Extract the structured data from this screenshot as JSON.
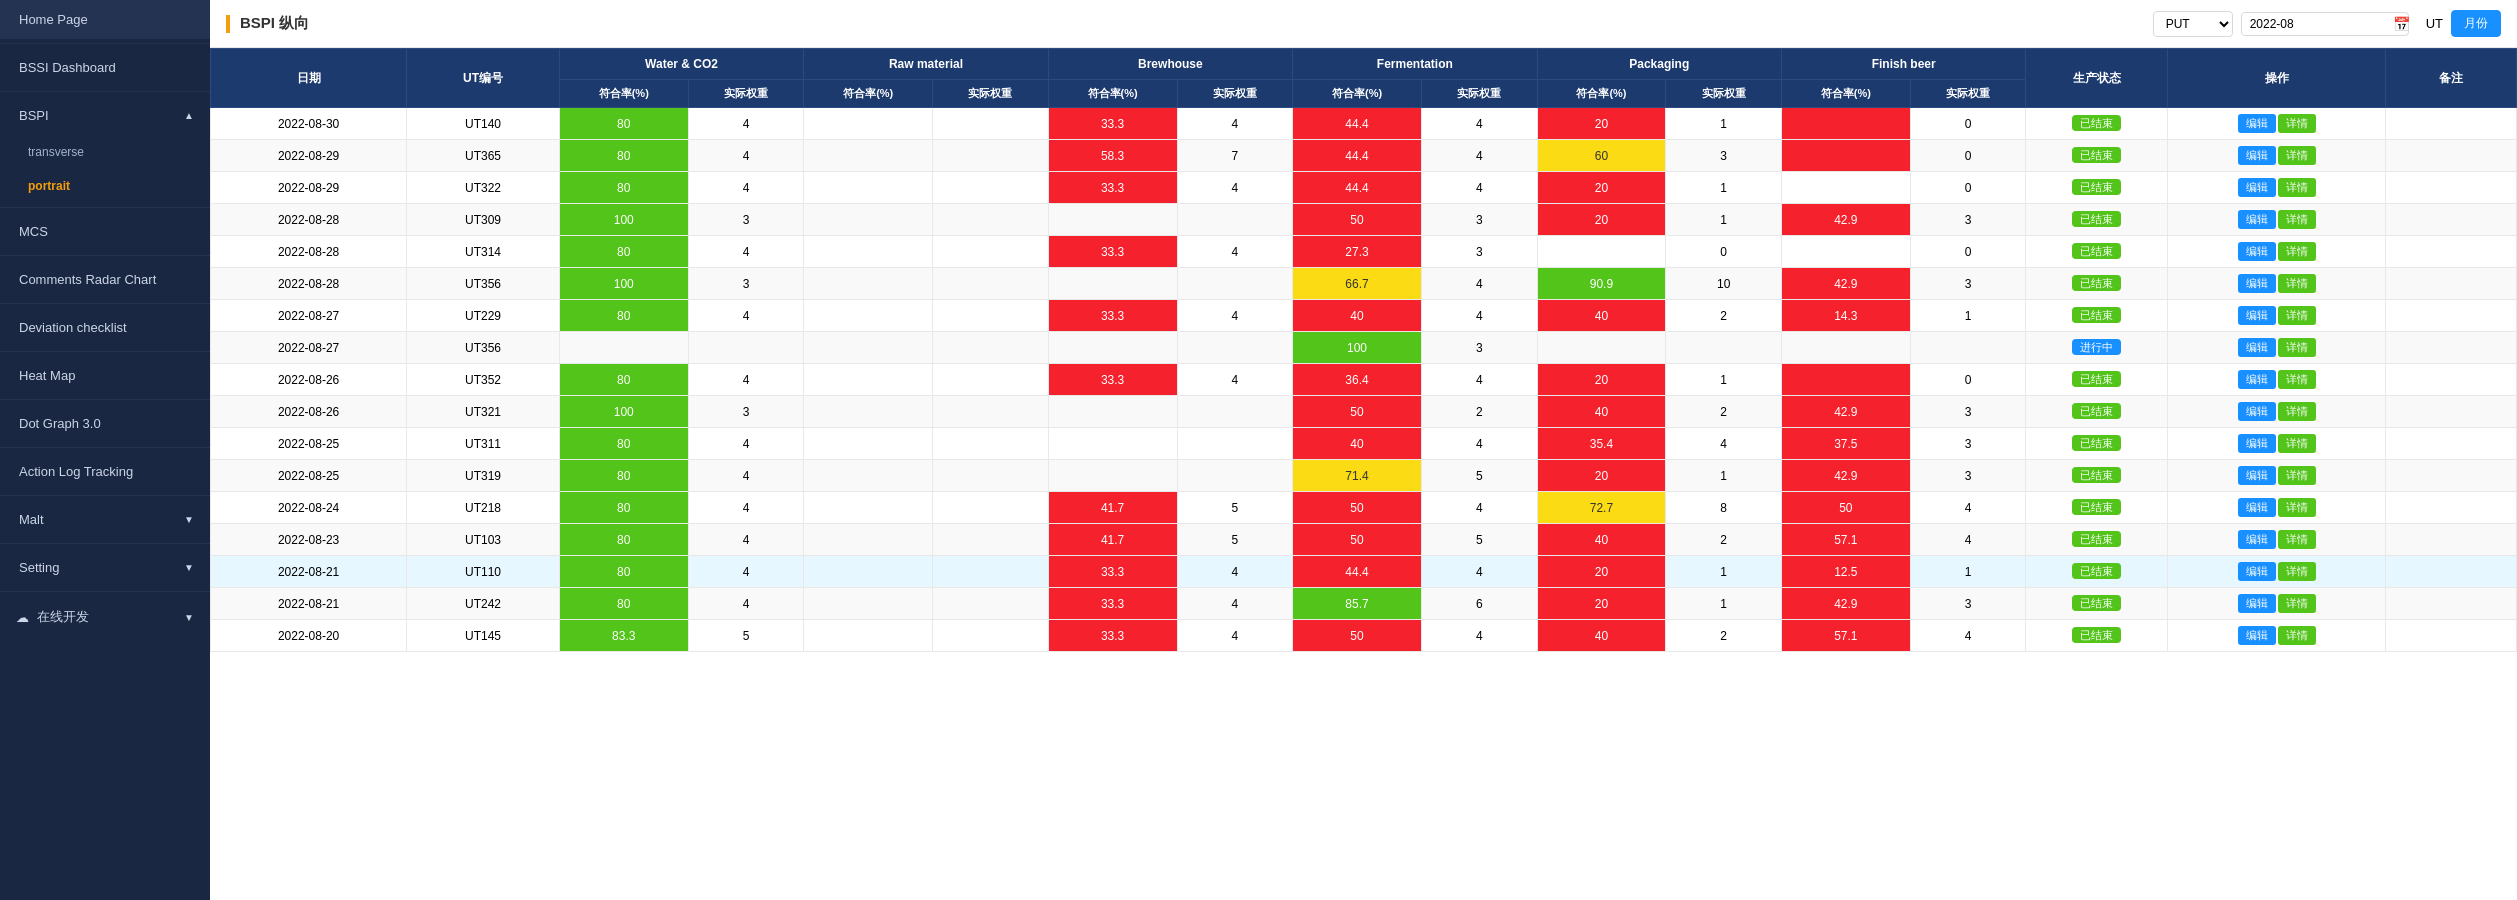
{
  "sidebar": {
    "logo": "Home Page",
    "items": [
      {
        "id": "home",
        "label": "Home Page",
        "active": false,
        "hasArrow": false
      },
      {
        "id": "bssi",
        "label": "BSSI Dashboard",
        "active": false,
        "hasArrow": false
      },
      {
        "id": "bspi",
        "label": "BSPI",
        "active": false,
        "hasArrow": true,
        "expanded": true
      },
      {
        "id": "transverse",
        "label": "transverse",
        "active": false,
        "isSub": true
      },
      {
        "id": "portrait",
        "label": "portrait",
        "active": true,
        "isSub": true
      },
      {
        "id": "mcs",
        "label": "MCS",
        "active": false,
        "hasArrow": false
      },
      {
        "id": "comments-radar",
        "label": "Comments Radar Chart",
        "active": false,
        "hasArrow": false
      },
      {
        "id": "deviation",
        "label": "Deviation checklist",
        "active": false,
        "hasArrow": false
      },
      {
        "id": "heatmap",
        "label": "Heat Map",
        "active": false,
        "hasArrow": false
      },
      {
        "id": "dotgraph",
        "label": "Dot Graph 3.0",
        "active": false,
        "hasArrow": false
      },
      {
        "id": "actionlog",
        "label": "Action Log Tracking",
        "active": false,
        "hasArrow": false
      },
      {
        "id": "malt",
        "label": "Malt",
        "active": false,
        "hasArrow": true
      },
      {
        "id": "setting",
        "label": "Setting",
        "active": false,
        "hasArrow": true
      },
      {
        "id": "online-dev",
        "label": "在线开发",
        "active": false,
        "hasArrow": true
      }
    ]
  },
  "topbar": {
    "title": "BSPI 纵向",
    "put_label": "PUT",
    "put_options": [
      "PUT"
    ],
    "date_value": "2022-08",
    "ut_label": "UT",
    "month_btn": "月份"
  },
  "table": {
    "headers_group": [
      {
        "label": "日期",
        "rowspan": 2,
        "colspan": 1
      },
      {
        "label": "UT编号",
        "rowspan": 2,
        "colspan": 1
      },
      {
        "label": "Water & CO2",
        "rowspan": 1,
        "colspan": 2
      },
      {
        "label": "Raw material",
        "rowspan": 1,
        "colspan": 2
      },
      {
        "label": "Brewhouse",
        "rowspan": 1,
        "colspan": 2
      },
      {
        "label": "Fermentation",
        "rowspan": 1,
        "colspan": 2
      },
      {
        "label": "Packaging",
        "rowspan": 1,
        "colspan": 2
      },
      {
        "label": "Finish beer",
        "rowspan": 1,
        "colspan": 2
      },
      {
        "label": "生产状态",
        "rowspan": 2,
        "colspan": 1
      },
      {
        "label": "操作",
        "rowspan": 2,
        "colspan": 1
      },
      {
        "label": "备注",
        "rowspan": 2,
        "colspan": 1
      }
    ],
    "sub_headers": [
      "符合率(%)",
      "实际权重",
      "符合率(%)",
      "实际权重",
      "符合率(%)",
      "实际权重",
      "符合率(%)",
      "实际权重",
      "符合率(%)",
      "实际权重",
      "符合率(%)",
      "实际权重"
    ],
    "rows": [
      {
        "date": "2022-08-30",
        "ut": "UT140",
        "highlighted": false,
        "water_rate": {
          "value": "80",
          "color": "green"
        },
        "water_weight": "4",
        "raw_rate": {
          "value": "",
          "color": ""
        },
        "raw_weight": "",
        "brew_rate": {
          "value": "33.3",
          "color": "red"
        },
        "brew_weight": "4",
        "ferm_rate": {
          "value": "44.4",
          "color": "red"
        },
        "ferm_weight": "4",
        "pack_rate": {
          "value": "20",
          "color": "red"
        },
        "pack_weight": "1",
        "finish_rate": {
          "value": "",
          "color": "red"
        },
        "finish_weight": "0",
        "status": "已结束",
        "status_type": "ended"
      },
      {
        "date": "2022-08-29",
        "ut": "UT365",
        "highlighted": false,
        "water_rate": {
          "value": "80",
          "color": "green"
        },
        "water_weight": "4",
        "raw_rate": {
          "value": "",
          "color": ""
        },
        "raw_weight": "",
        "brew_rate": {
          "value": "58.3",
          "color": "red"
        },
        "brew_weight": "7",
        "ferm_rate": {
          "value": "44.4",
          "color": "red"
        },
        "ferm_weight": "4",
        "pack_rate": {
          "value": "60",
          "color": "yellow"
        },
        "pack_weight": "3",
        "finish_rate": {
          "value": "",
          "color": "red"
        },
        "finish_weight": "0",
        "status": "已结束",
        "status_type": "ended"
      },
      {
        "date": "2022-08-29",
        "ut": "UT322",
        "highlighted": false,
        "water_rate": {
          "value": "80",
          "color": "green"
        },
        "water_weight": "4",
        "raw_rate": {
          "value": "",
          "color": ""
        },
        "raw_weight": "",
        "brew_rate": {
          "value": "33.3",
          "color": "red"
        },
        "brew_weight": "4",
        "ferm_rate": {
          "value": "44.4",
          "color": "red"
        },
        "ferm_weight": "4",
        "pack_rate": {
          "value": "20",
          "color": "red"
        },
        "pack_weight": "1",
        "finish_rate": {
          "value": "",
          "color": ""
        },
        "finish_weight": "0",
        "status": "已结束",
        "status_type": "ended"
      },
      {
        "date": "2022-08-28",
        "ut": "UT309",
        "highlighted": false,
        "water_rate": {
          "value": "100",
          "color": "green"
        },
        "water_weight": "3",
        "raw_rate": {
          "value": "",
          "color": ""
        },
        "raw_weight": "",
        "brew_rate": {
          "value": "",
          "color": ""
        },
        "brew_weight": "",
        "ferm_rate": {
          "value": "50",
          "color": "red"
        },
        "ferm_weight": "3",
        "pack_rate": {
          "value": "20",
          "color": "red"
        },
        "pack_weight": "1",
        "finish_rate": {
          "value": "42.9",
          "color": "red"
        },
        "finish_weight": "3",
        "status": "已结束",
        "status_type": "ended"
      },
      {
        "date": "2022-08-28",
        "ut": "UT314",
        "highlighted": false,
        "water_rate": {
          "value": "80",
          "color": "green"
        },
        "water_weight": "4",
        "raw_rate": {
          "value": "",
          "color": ""
        },
        "raw_weight": "",
        "brew_rate": {
          "value": "33.3",
          "color": "red"
        },
        "brew_weight": "4",
        "ferm_rate": {
          "value": "27.3",
          "color": "red"
        },
        "ferm_weight": "3",
        "pack_rate": {
          "value": "",
          "color": ""
        },
        "pack_weight": "0",
        "finish_rate": {
          "value": "",
          "color": ""
        },
        "finish_weight": "0",
        "status": "已结束",
        "status_type": "ended"
      },
      {
        "date": "2022-08-28",
        "ut": "UT356",
        "highlighted": false,
        "water_rate": {
          "value": "100",
          "color": "green"
        },
        "water_weight": "3",
        "raw_rate": {
          "value": "",
          "color": ""
        },
        "raw_weight": "",
        "brew_rate": {
          "value": "",
          "color": ""
        },
        "brew_weight": "",
        "ferm_rate": {
          "value": "66.7",
          "color": "yellow"
        },
        "ferm_weight": "4",
        "pack_rate": {
          "value": "90.9",
          "color": "green"
        },
        "pack_weight": "10",
        "finish_rate": {
          "value": "42.9",
          "color": "red"
        },
        "finish_weight": "3",
        "status": "已结束",
        "status_type": "ended"
      },
      {
        "date": "2022-08-27",
        "ut": "UT229",
        "highlighted": false,
        "water_rate": {
          "value": "80",
          "color": "green"
        },
        "water_weight": "4",
        "raw_rate": {
          "value": "",
          "color": ""
        },
        "raw_weight": "",
        "brew_rate": {
          "value": "33.3",
          "color": "red"
        },
        "brew_weight": "4",
        "ferm_rate": {
          "value": "40",
          "color": "red"
        },
        "ferm_weight": "4",
        "pack_rate": {
          "value": "40",
          "color": "red"
        },
        "pack_weight": "2",
        "finish_rate": {
          "value": "14.3",
          "color": "red"
        },
        "finish_weight": "1",
        "status": "已结束",
        "status_type": "ended"
      },
      {
        "date": "2022-08-27",
        "ut": "UT356",
        "highlighted": false,
        "water_rate": {
          "value": "",
          "color": ""
        },
        "water_weight": "",
        "raw_rate": {
          "value": "",
          "color": ""
        },
        "raw_weight": "",
        "brew_rate": {
          "value": "",
          "color": ""
        },
        "brew_weight": "",
        "ferm_rate": {
          "value": "100",
          "color": "green"
        },
        "ferm_weight": "3",
        "pack_rate": {
          "value": "",
          "color": ""
        },
        "pack_weight": "",
        "finish_rate": {
          "value": "",
          "color": ""
        },
        "finish_weight": "",
        "status": "进行中",
        "status_type": "ongoing"
      },
      {
        "date": "2022-08-26",
        "ut": "UT352",
        "highlighted": false,
        "water_rate": {
          "value": "80",
          "color": "green"
        },
        "water_weight": "4",
        "raw_rate": {
          "value": "",
          "color": ""
        },
        "raw_weight": "",
        "brew_rate": {
          "value": "33.3",
          "color": "red"
        },
        "brew_weight": "4",
        "ferm_rate": {
          "value": "36.4",
          "color": "red"
        },
        "ferm_weight": "4",
        "pack_rate": {
          "value": "20",
          "color": "red"
        },
        "pack_weight": "1",
        "finish_rate": {
          "value": "",
          "color": "red"
        },
        "finish_weight": "0",
        "status": "已结束",
        "status_type": "ended"
      },
      {
        "date": "2022-08-26",
        "ut": "UT321",
        "highlighted": false,
        "water_rate": {
          "value": "100",
          "color": "green"
        },
        "water_weight": "3",
        "raw_rate": {
          "value": "",
          "color": ""
        },
        "raw_weight": "",
        "brew_rate": {
          "value": "",
          "color": ""
        },
        "brew_weight": "",
        "ferm_rate": {
          "value": "50",
          "color": "red"
        },
        "ferm_weight": "2",
        "pack_rate": {
          "value": "40",
          "color": "red"
        },
        "pack_weight": "2",
        "finish_rate": {
          "value": "42.9",
          "color": "red"
        },
        "finish_weight": "3",
        "status": "已结束",
        "status_type": "ended"
      },
      {
        "date": "2022-08-25",
        "ut": "UT311",
        "highlighted": false,
        "water_rate": {
          "value": "80",
          "color": "green"
        },
        "water_weight": "4",
        "raw_rate": {
          "value": "",
          "color": ""
        },
        "raw_weight": "",
        "brew_rate": {
          "value": "",
          "color": ""
        },
        "brew_weight": "",
        "ferm_rate": {
          "value": "40",
          "color": "red"
        },
        "ferm_weight": "4",
        "pack_rate": {
          "value": "35.4",
          "color": "red"
        },
        "pack_weight": "4",
        "finish_rate": {
          "value": "37.5",
          "color": "red"
        },
        "finish_weight": "3",
        "status": "已结束",
        "status_type": "ended"
      },
      {
        "date": "2022-08-25",
        "ut": "UT319",
        "highlighted": false,
        "water_rate": {
          "value": "80",
          "color": "green"
        },
        "water_weight": "4",
        "raw_rate": {
          "value": "",
          "color": ""
        },
        "raw_weight": "",
        "brew_rate": {
          "value": "",
          "color": ""
        },
        "brew_weight": "",
        "ferm_rate": {
          "value": "71.4",
          "color": "yellow"
        },
        "ferm_weight": "5",
        "pack_rate": {
          "value": "20",
          "color": "red"
        },
        "pack_weight": "1",
        "finish_rate": {
          "value": "42.9",
          "color": "red"
        },
        "finish_weight": "3",
        "status": "已结束",
        "status_type": "ended"
      },
      {
        "date": "2022-08-24",
        "ut": "UT218",
        "highlighted": false,
        "water_rate": {
          "value": "80",
          "color": "green"
        },
        "water_weight": "4",
        "raw_rate": {
          "value": "",
          "color": ""
        },
        "raw_weight": "",
        "brew_rate": {
          "value": "41.7",
          "color": "red"
        },
        "brew_weight": "5",
        "ferm_rate": {
          "value": "50",
          "color": "red"
        },
        "ferm_weight": "4",
        "pack_rate": {
          "value": "72.7",
          "color": "yellow"
        },
        "pack_weight": "8",
        "finish_rate": {
          "value": "50",
          "color": "red"
        },
        "finish_weight": "4",
        "status": "已结束",
        "status_type": "ended"
      },
      {
        "date": "2022-08-23",
        "ut": "UT103",
        "highlighted": false,
        "water_rate": {
          "value": "80",
          "color": "green"
        },
        "water_weight": "4",
        "raw_rate": {
          "value": "",
          "color": ""
        },
        "raw_weight": "",
        "brew_rate": {
          "value": "41.7",
          "color": "red"
        },
        "brew_weight": "5",
        "ferm_rate": {
          "value": "50",
          "color": "red"
        },
        "ferm_weight": "5",
        "pack_rate": {
          "value": "40",
          "color": "red"
        },
        "pack_weight": "2",
        "finish_rate": {
          "value": "57.1",
          "color": "red"
        },
        "finish_weight": "4",
        "status": "已结束",
        "status_type": "ended"
      },
      {
        "date": "2022-08-21",
        "ut": "UT110",
        "highlighted": true,
        "water_rate": {
          "value": "80",
          "color": "green"
        },
        "water_weight": "4",
        "raw_rate": {
          "value": "",
          "color": ""
        },
        "raw_weight": "",
        "brew_rate": {
          "value": "33.3",
          "color": "red"
        },
        "brew_weight": "4",
        "ferm_rate": {
          "value": "44.4",
          "color": "red"
        },
        "ferm_weight": "4",
        "pack_rate": {
          "value": "20",
          "color": "red"
        },
        "pack_weight": "1",
        "finish_rate": {
          "value": "12.5",
          "color": "red"
        },
        "finish_weight": "1",
        "status": "已结束",
        "status_type": "ended"
      },
      {
        "date": "2022-08-21",
        "ut": "UT242",
        "highlighted": false,
        "water_rate": {
          "value": "80",
          "color": "green"
        },
        "water_weight": "4",
        "raw_rate": {
          "value": "",
          "color": ""
        },
        "raw_weight": "",
        "brew_rate": {
          "value": "33.3",
          "color": "red"
        },
        "brew_weight": "4",
        "ferm_rate": {
          "value": "85.7",
          "color": "green"
        },
        "ferm_weight": "6",
        "pack_rate": {
          "value": "20",
          "color": "red"
        },
        "pack_weight": "1",
        "finish_rate": {
          "value": "42.9",
          "color": "red"
        },
        "finish_weight": "3",
        "status": "已结束",
        "status_type": "ended"
      },
      {
        "date": "2022-08-20",
        "ut": "UT145",
        "highlighted": false,
        "water_rate": {
          "value": "83.3",
          "color": "green"
        },
        "water_weight": "5",
        "raw_rate": {
          "value": "",
          "color": ""
        },
        "raw_weight": "",
        "brew_rate": {
          "value": "33.3",
          "color": "red"
        },
        "brew_weight": "4",
        "ferm_rate": {
          "value": "50",
          "color": "red"
        },
        "ferm_weight": "4",
        "pack_rate": {
          "value": "40",
          "color": "red"
        },
        "pack_weight": "2",
        "finish_rate": {
          "value": "57.1",
          "color": "red"
        },
        "finish_weight": "4",
        "status": "已结束",
        "status_type": "ended"
      }
    ],
    "btn_edit": "编辑",
    "btn_detail": "详情",
    "col_match": "符合率(%)",
    "col_weight": "实际权重",
    "col_date": "日期",
    "col_ut": "UT编号",
    "col_status": "生产状态",
    "col_action": "操作",
    "col_remark": "备注"
  }
}
